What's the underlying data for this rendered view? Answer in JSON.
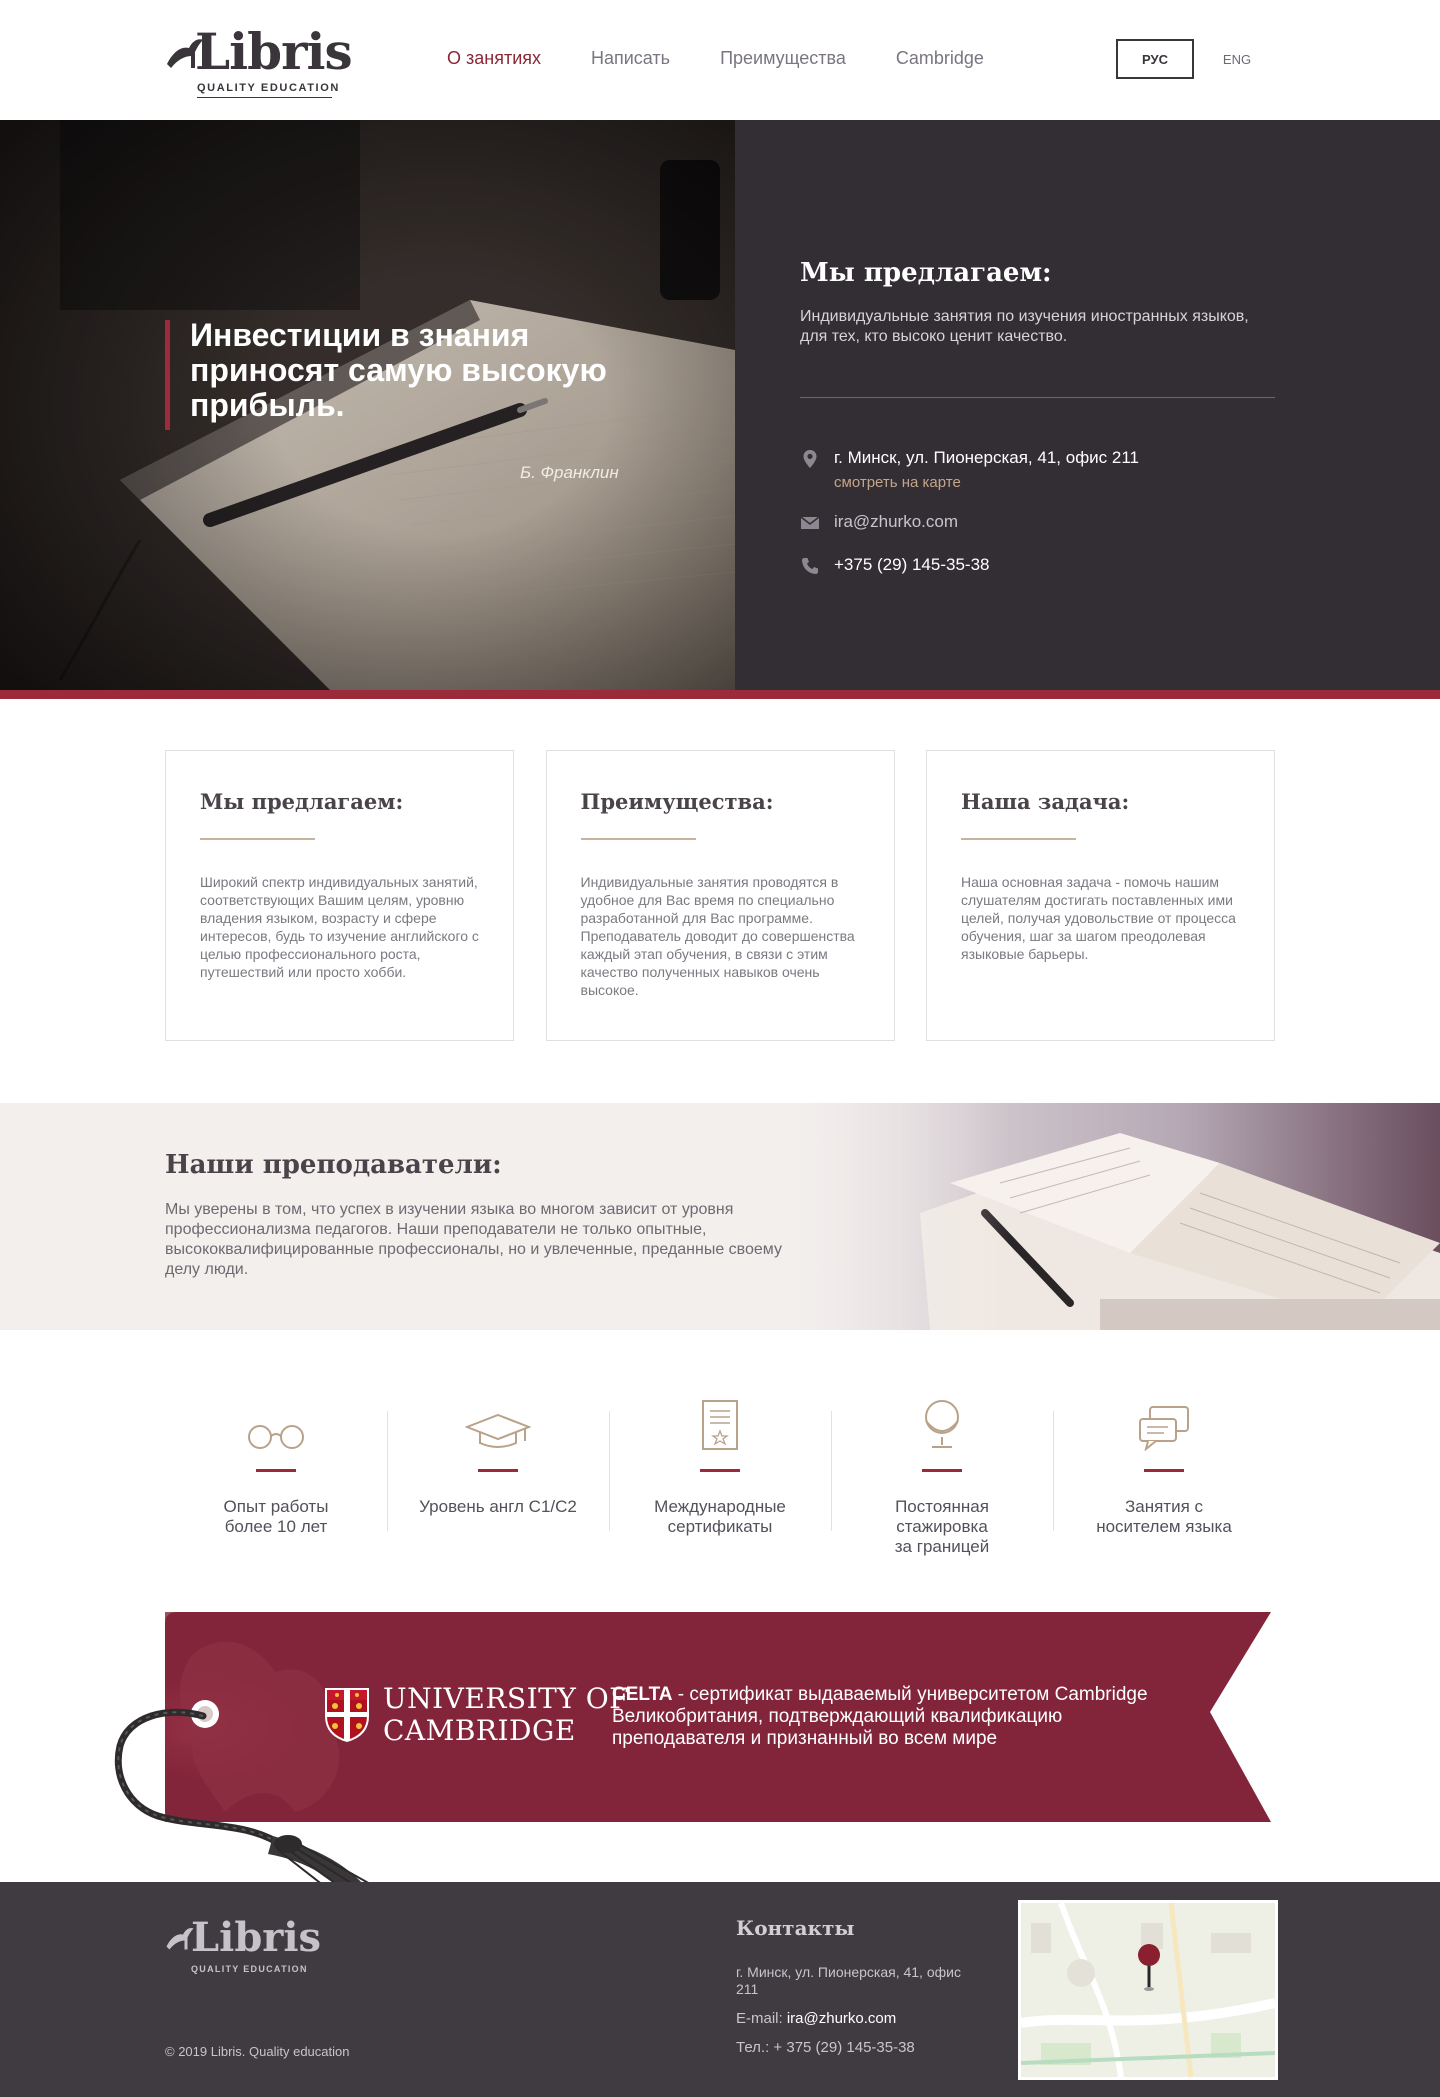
{
  "header": {
    "logo_word": "Libris",
    "logo_tag": "QUALITY EDUCATION",
    "nav": [
      {
        "label": "О занятиях",
        "active": true
      },
      {
        "label": "Написать",
        "active": false
      },
      {
        "label": "Преимущества",
        "active": false
      },
      {
        "label": "Cambridge",
        "active": false
      }
    ],
    "lang_ru": "РУС",
    "lang_en": "ENG"
  },
  "hero": {
    "quote": "Инвестиции в знания приносят самую высокую прибыль.",
    "author": "Б. Франклин",
    "panel_title": "Мы предлагаем:",
    "panel_text": "Индивидуальные занятия по изучения иностранных языков, для тех, кто высоко ценит качество.",
    "address": "г. Минск, ул. Пионерская, 41, офис 211",
    "map_link": "смотреть на карте",
    "email": "ira@zhurko.com",
    "phone": "+375 (29) 145-35-38"
  },
  "cards": [
    {
      "title": "Мы предлагаем:",
      "text": "Широкий спектр индивидуальных занятий, соответствующих Вашим целям, уровню владения языком, возрасту и сфере интересов, будь то изучение английского с целью профессионального роста, путешествий или просто хобби."
    },
    {
      "title": "Преимущества:",
      "text": "Индивидуальные занятия проводятся в удобное для Вас время по специально разработанной для Вас программе. Преподаватель доводит до совершенства каждый этап обучения, в связи с этим качество полученных навыков очень высокое."
    },
    {
      "title": "Наша задача:",
      "text": "Наша основная задача - помочь нашим слушателям достигать  поставленных ими целей, получая удовольствие от процесса обучения, шаг за шагом преодолевая языковые барьеры."
    }
  ],
  "teachers": {
    "title": "Наши преподаватели:",
    "text": "Мы уверены в том, что успех в изучении языка во многом зависит от уровня профессионализма педагогов. Наши преподаватели не только опытные, высококвалифицированные профессионалы, но и увлеченные, преданные своему делу люди."
  },
  "features": [
    {
      "icon": "glasses-icon",
      "label": "Опыт работы\nболее 10 лет"
    },
    {
      "icon": "graduation-cap-icon",
      "label": "Уровень англ С1/С2"
    },
    {
      "icon": "certificate-icon",
      "label": "Международные\nсертификаты"
    },
    {
      "icon": "globe-icon",
      "label": "Постоянная\nстажировка\nза границей"
    },
    {
      "icon": "chat-bubbles-icon",
      "label": "Занятия с\nносителем языка"
    }
  ],
  "banner": {
    "uni_line1": "UNIVERSITY OF",
    "uni_line2": "CAMBRIDGE",
    "celta_strong": "CELTA",
    "celta_rest": " - сертификат выдаваемый университетом Cambridge Великобритания, подтверждающий квалификацию преподавателя и признанный во всем мире"
  },
  "footer": {
    "logo_word": "Libris",
    "logo_tag": "QUALITY EDUCATION",
    "copyright": "© 2019 Libris. Quality education",
    "contacts_title": "Контакты",
    "address": "г. Минск, ул. Пионерская, 41, офис 211",
    "email_label": "E-mail: ",
    "email": "ira@zhurko.com",
    "phone_label": "Тел.: ",
    "phone": "+ 375 (29) 145-35-38"
  },
  "colors": {
    "accent": "#9b2a3a",
    "dark_panel": "#332e34",
    "footer": "#3f3b40",
    "banner": "#83253a"
  }
}
